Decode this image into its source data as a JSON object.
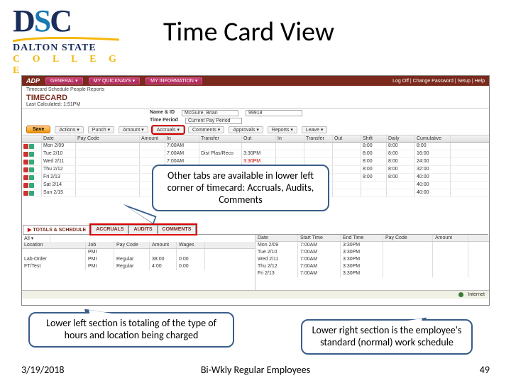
{
  "logo": {
    "dsc_d": "D",
    "dsc_s": "S",
    "dsc_c": "C",
    "line1": "DALTON STATE",
    "line2": "C O L L E G E"
  },
  "title": "Time Card View",
  "adp": {
    "brand": "ADP",
    "nav": [
      "GENERAL ▾",
      "MY QUICKNAVS ▾",
      "MY INFORMATION ▾"
    ],
    "top_right": "Log Off | Change Password | Setup | Help",
    "breadcrumb": "Timecard   Schedule   People   Reports",
    "page_title": "TIMECARD",
    "last_calc": "Last Calculated: 1:51PM",
    "name_label": "Name & ID",
    "name_value": "McGuire, Brian",
    "name_id": "99918",
    "period_label": "Time Period",
    "period_value": "Current Pay Period",
    "save": "Save",
    "menus": [
      "Actions ▾",
      "Punch ▾",
      "Amount ▾",
      "Accruals ▾",
      "Comments ▾",
      "Approvals ▾",
      "Reports ▾",
      "Leave ▾"
    ],
    "cols": [
      "",
      "Date",
      "Pay Code",
      "Amount",
      "In",
      "Transfer",
      "Out",
      "In",
      "Transfer",
      "Out",
      "Shift",
      "Daily",
      "Cumulative"
    ],
    "rows": [
      {
        "date": "Mon 2/09",
        "in": "7:00AM",
        "out": "",
        "shift": "8:00",
        "daily": "8:00",
        "cum": "8:00"
      },
      {
        "date": "Tue 2/10",
        "in": "7:00AM",
        "xfer": "Dist Plas/Reco",
        "out": "3:30PM",
        "shift": "8:00",
        "daily": "8:00",
        "cum": "16:00"
      },
      {
        "date": "Wed 2/11",
        "in": "7:00AM",
        "out": "3:30PM",
        "outcls": "red",
        "shift": "8:00",
        "daily": "8:00",
        "cum": "24:00"
      },
      {
        "date": "Thu 2/12",
        "in": "",
        "out": "",
        "shift": "8:00",
        "daily": "8:00",
        "cum": "32:00"
      },
      {
        "date": "Fri 2/13",
        "in": "",
        "out": "",
        "shift": "8:00",
        "daily": "8:00",
        "cum": "40:00"
      },
      {
        "date": "Sat 2/14",
        "in": "",
        "out": "",
        "shift": "",
        "daily": "",
        "cum": "40:00"
      },
      {
        "date": "Sun 2/15",
        "in": "",
        "out": "",
        "shift": "",
        "daily": "",
        "cum": "40:00"
      }
    ],
    "lower_tabs": [
      "TOTALS & SCHEDULE",
      "ACCRUALS",
      "AUDITS",
      "COMMENTS"
    ],
    "left_filter": "All ▾",
    "left_cols": [
      "Location",
      "Job",
      "Pay Code",
      "Amount",
      "Wages"
    ],
    "left_rows": [
      {
        "loc": "",
        "job": "PMr",
        "pc": "",
        "amt": "",
        "wages": ""
      },
      {
        "loc": "Lab-Order",
        "job": "PMr",
        "pc": "Regular",
        "amt": "38:00",
        "wages": "0.00"
      },
      {
        "loc": "FT/Test",
        "job": "PMr",
        "pc": "Regular",
        "amt": "4:00",
        "wages": "0.00"
      }
    ],
    "right_cols": [
      "Date",
      "Start Time",
      "End Time",
      "Pay Code",
      "Amount"
    ],
    "right_rows": [
      {
        "date": "Mon 2/09",
        "st": "7:00AM",
        "et": "3:30PM"
      },
      {
        "date": "Tue 2/10",
        "st": "7:00AM",
        "et": "3:30PM"
      },
      {
        "date": "Wed 2/11",
        "st": "7:00AM",
        "et": "3:30PM"
      },
      {
        "date": "Thu 2/12",
        "st": "7:00AM",
        "et": "3:30PM"
      },
      {
        "date": "Fri 2/13",
        "st": "7:00AM",
        "et": "3:30PM"
      }
    ],
    "status": "Internet"
  },
  "callouts": {
    "c1": "Other tabs are available in lower left corner of timecard: Accruals, Audits, Comments",
    "c2": "Lower left section is totaling of the type of hours and location being charged",
    "c3": "Lower right section is the employee's standard (normal) work schedule"
  },
  "footer": {
    "date": "3/19/2018",
    "center": "Bi-Wkly Regular Employees",
    "page": "49"
  }
}
